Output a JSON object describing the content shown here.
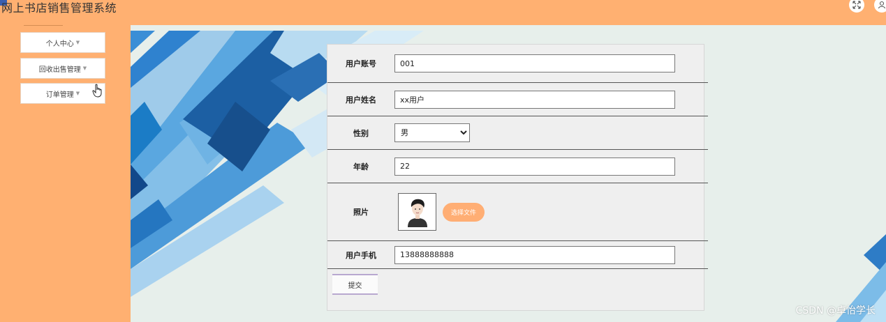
{
  "app": {
    "title": "网上书店销售管理系统"
  },
  "sidebar": {
    "items": [
      {
        "label": "个人中心"
      },
      {
        "label": "回收出售管理"
      },
      {
        "label": "订单管理"
      }
    ]
  },
  "form": {
    "account": {
      "label": "用户账号",
      "value": "001"
    },
    "name": {
      "label": "用户姓名",
      "value": "xx用户"
    },
    "gender": {
      "label": "性别",
      "value": "男"
    },
    "age": {
      "label": "年龄",
      "value": "22"
    },
    "photo": {
      "label": "照片",
      "choose_label": "选择文件"
    },
    "phone": {
      "label": "用户手机",
      "value": "13888888888"
    },
    "submit_label": "提交"
  },
  "watermark": "CSDN @卓怡学长",
  "colors": {
    "accent": "#ffb071",
    "content_bg": "#e7efeb",
    "deco_blue": "#1f6fb5"
  }
}
